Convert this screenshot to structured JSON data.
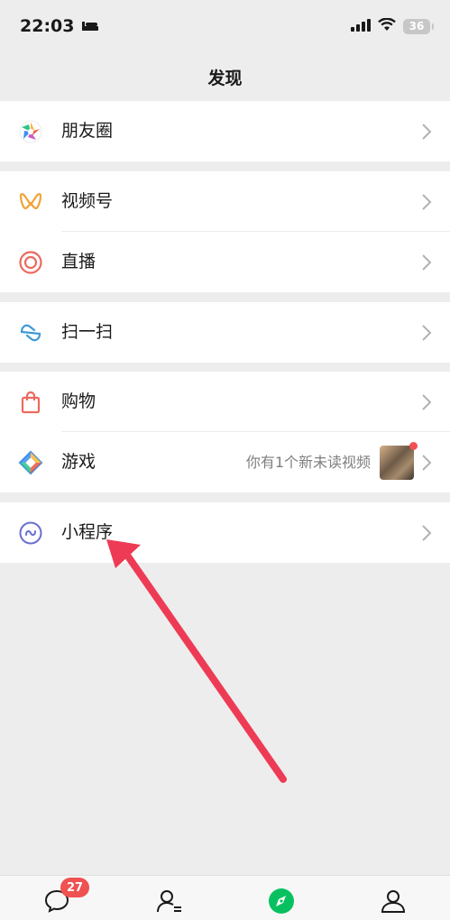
{
  "status_bar": {
    "time": "22:03",
    "battery": "36"
  },
  "nav": {
    "title": "发现"
  },
  "groups": [
    {
      "items": [
        {
          "label": "朋友圈",
          "icon": "moments-icon"
        }
      ]
    },
    {
      "items": [
        {
          "label": "视频号",
          "icon": "channels-icon"
        },
        {
          "label": "直播",
          "icon": "live-icon"
        }
      ]
    },
    {
      "items": [
        {
          "label": "扫一扫",
          "icon": "scan-icon"
        }
      ]
    },
    {
      "items": [
        {
          "label": "购物",
          "icon": "shopping-icon"
        },
        {
          "label": "游戏",
          "icon": "games-icon",
          "subtext": "你有1个新未读视频"
        }
      ]
    },
    {
      "items": [
        {
          "label": "小程序",
          "icon": "mini-programs-icon"
        }
      ]
    }
  ],
  "tabbar": {
    "chats_badge": "27",
    "tabs": [
      {
        "name": "chats",
        "icon": "chat-bubble-icon"
      },
      {
        "name": "contacts",
        "icon": "contacts-icon"
      },
      {
        "name": "discover",
        "icon": "compass-icon",
        "active": true
      },
      {
        "name": "me",
        "icon": "person-icon"
      }
    ]
  },
  "colors": {
    "background": "#ededed",
    "card": "#ffffff",
    "accent_green": "#07c160",
    "badge_red": "#f05151",
    "annotation_arrow": "#ee3b55"
  }
}
